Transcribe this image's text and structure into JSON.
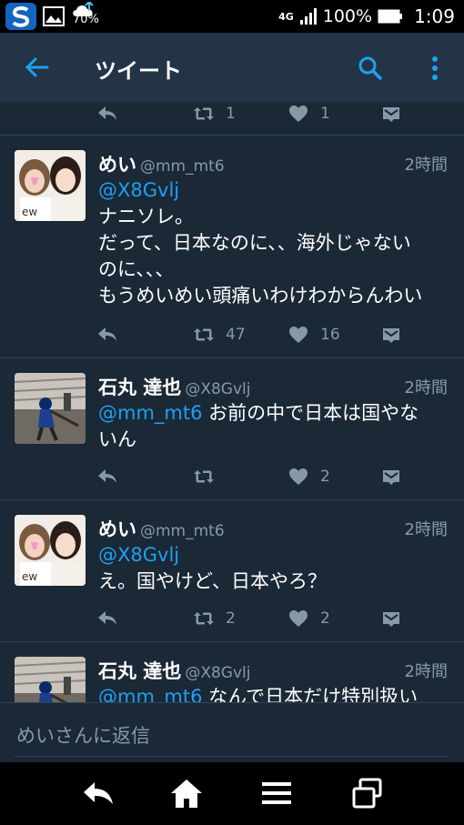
{
  "status_bar": {
    "weather_percent": "70%",
    "network": "4G",
    "battery": "100%",
    "time": "1:09"
  },
  "app_bar": {
    "title": "ツイート"
  },
  "partial_tweet": {
    "retweets": "1",
    "likes": "1"
  },
  "tweets": [
    {
      "name": "めい",
      "handle": "@mm_mt6",
      "time": "2時間",
      "mention": "@X8Gvlj",
      "lines": [
        "ナニソレ。",
        "だって、日本なのに、、海外じゃない",
        "のに、、、",
        "もうめいめい頭痛いわけわからんわい"
      ],
      "retweets": "47",
      "likes": "16"
    },
    {
      "name": "石丸 達也",
      "handle": "@X8Gvlj",
      "time": "2時間",
      "mention": "@mm_mt6",
      "first_line_rest": " お前の中で日本は国やな",
      "lines": [
        "いん"
      ],
      "retweets": "",
      "likes": "2"
    },
    {
      "name": "めい",
      "handle": "@mm_mt6",
      "time": "2時間",
      "mention": "@X8Gvlj",
      "lines": [
        "え。国やけど、日本やろ？"
      ],
      "retweets": "2",
      "likes": "2"
    },
    {
      "name": "石丸 達也",
      "handle": "@X8Gvlj",
      "time": "2時間",
      "mention": "@mm_mt6",
      "first_line_rest": " なんで日本だけ特別扱い"
    }
  ],
  "reply_bar": {
    "placeholder": "めいさんに返信"
  },
  "colors": {
    "background": "#1b2836",
    "appbar": "#243447",
    "accent": "#1da1f2",
    "secondary_text": "#8899a6"
  },
  "icons": [
    "back-arrow-icon",
    "search-icon",
    "more-vert-icon",
    "reply-icon",
    "retweet-icon",
    "heart-icon",
    "direct-message-icon",
    "nav-back-icon",
    "nav-home-icon",
    "nav-menu-icon",
    "nav-recents-icon"
  ]
}
